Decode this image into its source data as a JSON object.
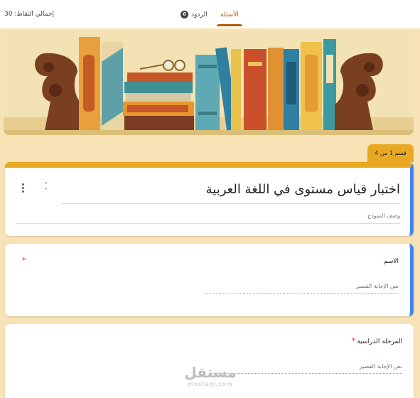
{
  "topbar": {
    "total_points": "إجمالي النقاط: 30",
    "tabs": {
      "questions": "الأسئلة",
      "responses": "الردود",
      "responses_count": "6"
    }
  },
  "section": {
    "label": "قسم 1 من 4"
  },
  "form": {
    "title": "اختبار قياس مستوى في اللغة العربية",
    "description": "وصف النموذج"
  },
  "questions": [
    {
      "label": "الاسم",
      "required_mark": "*",
      "answer_placeholder": "نص الإجابة القصير"
    },
    {
      "label": "المرحلة الدراسية",
      "required_mark": "*",
      "answer_placeholder": "نص الإجابة القصير"
    }
  ],
  "watermark": {
    "arabic": "مستقل",
    "latin": "mostaql.com"
  },
  "colors": {
    "page_background": "#f7e3b5",
    "accent": "#e8a821",
    "active_tab": "#b06000",
    "focus_bar": "#4285f4",
    "required": "#d93025"
  },
  "icons": [
    "more-vert-icon",
    "collapse-icon"
  ]
}
